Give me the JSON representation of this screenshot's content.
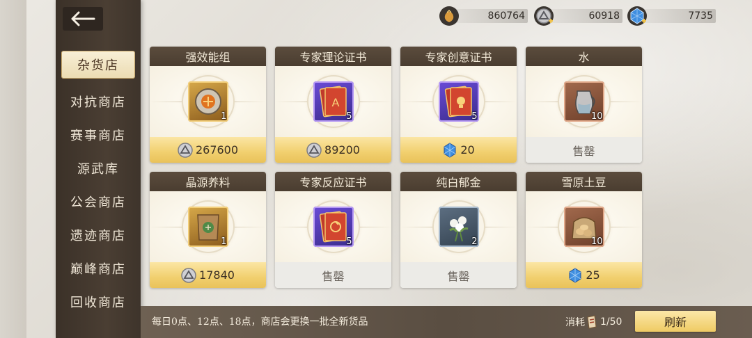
{
  "currencies": [
    {
      "icon": "gold-pouch-icon",
      "value": "860764"
    },
    {
      "icon": "silver-coin-icon",
      "value": "60918"
    },
    {
      "icon": "blue-crystal-icon",
      "value": "7735"
    }
  ],
  "nav": {
    "back_icon": "back-arrow-icon",
    "items": [
      {
        "label": "杂货店",
        "active": true
      },
      {
        "label": "对抗商店"
      },
      {
        "label": "赛事商店"
      },
      {
        "label": "源武库"
      },
      {
        "label": "公会商店"
      },
      {
        "label": "遗迹商店"
      },
      {
        "label": "巅峰商店"
      },
      {
        "label": "回收商店"
      }
    ]
  },
  "shop": {
    "items": [
      {
        "name": "强效能组",
        "icon": "energy-core-icon",
        "qty": "1",
        "status": "price",
        "currency": "silver-coin-icon",
        "price": "267600"
      },
      {
        "name": "专家理论证书",
        "icon": "theory-certificate-icon",
        "qty": "5",
        "status": "price",
        "currency": "silver-coin-icon",
        "price": "89200"
      },
      {
        "name": "专家创意证书",
        "icon": "creative-certificate-icon",
        "qty": "5",
        "status": "price",
        "currency": "blue-crystal-icon",
        "price": "20"
      },
      {
        "name": "水",
        "icon": "water-jug-icon",
        "qty": "10",
        "status": "sold",
        "sold_label": "售罄"
      },
      {
        "name": "晶源养料",
        "icon": "nutrient-bag-icon",
        "qty": "1",
        "status": "price",
        "currency": "silver-coin-icon",
        "price": "17840"
      },
      {
        "name": "专家反应证书",
        "icon": "reaction-certificate-icon",
        "qty": "5",
        "status": "sold",
        "sold_label": "售罄"
      },
      {
        "name": "纯白郁金",
        "icon": "white-flower-icon",
        "qty": "2",
        "status": "sold",
        "sold_label": "售罄"
      },
      {
        "name": "雪原土豆",
        "icon": "potato-sack-icon",
        "qty": "10",
        "status": "price",
        "currency": "blue-crystal-icon",
        "price": "25"
      }
    ]
  },
  "footer": {
    "notice": "每日0点、12点、18点，商店会更换一批全新货品",
    "consume_label": "消耗",
    "consume_icon": "refresh-token-icon",
    "consume_count": "1/50",
    "refresh_label": "刷新"
  }
}
